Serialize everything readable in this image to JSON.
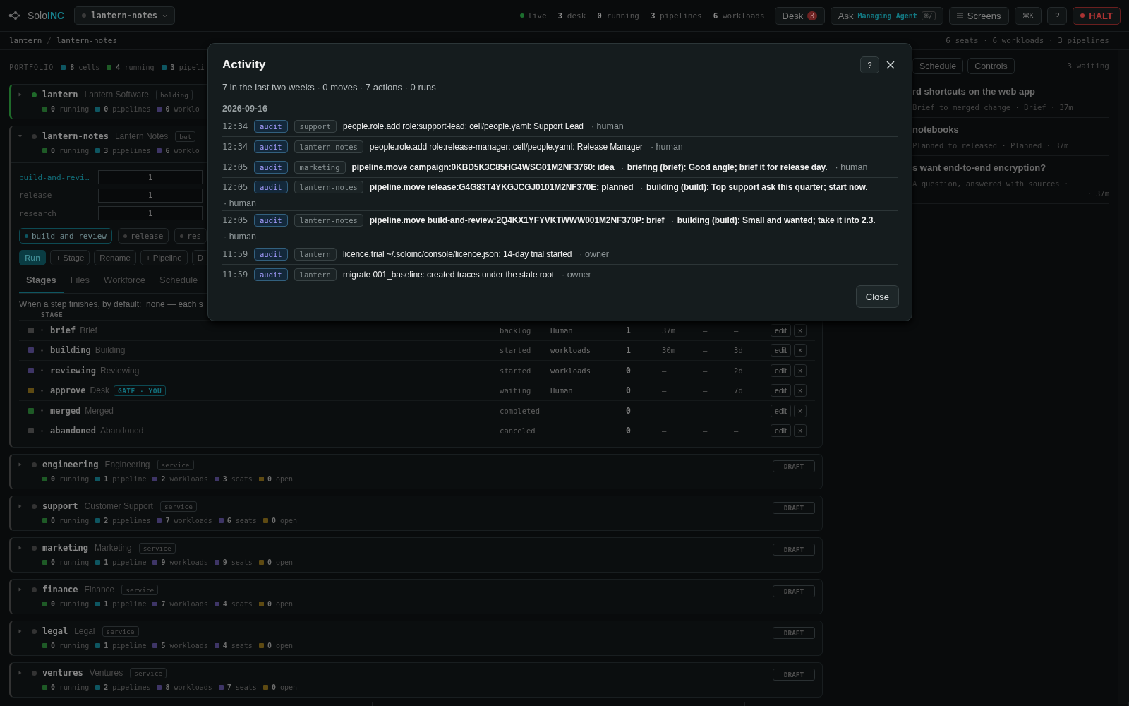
{
  "topbar": {
    "brand": {
      "prefix": "Solo",
      "suffix": "INC"
    },
    "project": "lantern-notes",
    "live": {
      "label": "live",
      "on": true
    },
    "counts": [
      "**3** desk",
      "**0** running",
      "**3** pipelines",
      "**6** workloads"
    ],
    "desk": {
      "label": "Desk",
      "badge": "3"
    },
    "ask": {
      "label": "Ask",
      "agent": "Managing Agent",
      "shortcut": "⌘/"
    },
    "screens": "Screens",
    "command": "⌘K",
    "help": "?",
    "halt": "HALT"
  },
  "breadcrumb": {
    "items": [
      "lantern",
      "lantern-notes"
    ],
    "separator": "/",
    "summary": "6 seats · 6 workloads · 3 pipelines"
  },
  "portfolio": {
    "label": "PORTFOLIO",
    "stats": [
      {
        "value": "8",
        "label": "cells",
        "color": "#0e5661"
      },
      {
        "value": "4",
        "label": "running",
        "color": "#1e5a26"
      },
      {
        "value": "3",
        "label": "pipeli",
        "color": "#0e5661"
      }
    ]
  },
  "cells": [
    {
      "name": "lantern",
      "title": "Lantern Software",
      "tag": "holding",
      "color": "#1f6a2a",
      "expanded": false,
      "stats": [
        {
          "value": "0",
          "label": "running",
          "color": "#1e5a26"
        },
        {
          "value": "0",
          "label": "pipelines",
          "color": "#0e5661"
        },
        {
          "value": "0",
          "label": "worklo",
          "color": "#3e3566"
        }
      ]
    },
    {
      "name": "lantern-notes",
      "title": "Lantern Notes",
      "tag": "bet",
      "color": "#333333",
      "expanded": true,
      "stats": [
        {
          "value": "0",
          "label": "running",
          "color": "#1e5a26"
        },
        {
          "value": "3",
          "label": "pipelines",
          "color": "#0e5661"
        },
        {
          "value": "6",
          "label": "worklo",
          "color": "#3e3566"
        }
      ],
      "detail": {
        "pipelines": [
          {
            "name": "build-and-revi…",
            "value": "1",
            "selected": true
          },
          {
            "name": "release",
            "value": "1",
            "selected": false
          },
          {
            "name": "research",
            "value": "1",
            "selected": false
          }
        ],
        "pills": [
          {
            "label": "build-and-review",
            "selected": true
          },
          {
            "label": "release",
            "selected": false
          },
          {
            "label": "res",
            "selected": false
          }
        ],
        "actions": [
          {
            "label": "Run",
            "kind": "primary"
          },
          {
            "label": "+ Stage",
            "kind": "secondary"
          },
          {
            "label": "Rename",
            "kind": "secondary"
          },
          {
            "label": "+ Pipeline",
            "kind": "secondary"
          },
          {
            "label": "D",
            "kind": "secondary"
          }
        ],
        "tabs": [
          {
            "label": "Stages",
            "selected": true
          },
          {
            "label": "Files",
            "selected": false
          },
          {
            "label": "Workforce",
            "selected": false
          },
          {
            "label": "Schedule",
            "selected": false
          }
        ],
        "hint": "When a step finishes, by default:  none — each s",
        "column": "STAGE",
        "stages": [
          {
            "name": "brief",
            "title": "Brief",
            "state": "backlog",
            "owner": "Human",
            "count": "1",
            "age": "37m",
            "col_a": "—",
            "col_b": "—",
            "color": "#3a3a3a",
            "edit": "edit",
            "remove": "×"
          },
          {
            "name": "building",
            "title": "Building",
            "state": "started",
            "owner": "workloads",
            "count": "1",
            "age": "30m",
            "col_a": "—",
            "col_b": "3d",
            "color": "#3e3566",
            "edit": "edit",
            "remove": "×"
          },
          {
            "name": "reviewing",
            "title": "Reviewing",
            "state": "started",
            "owner": "workloads",
            "count": "0",
            "age": "—",
            "col_a": "—",
            "col_b": "2d",
            "color": "#3e3566",
            "edit": "edit",
            "remove": "×"
          },
          {
            "name": "approve",
            "title": "Desk",
            "tag": "GATE · YOU",
            "state": "waiting",
            "owner": "Human",
            "count": "0",
            "age": "—",
            "col_a": "—",
            "col_b": "7d",
            "color": "#5e4a12",
            "edit": "edit",
            "remove": "×"
          },
          {
            "name": "merged",
            "title": "Merged",
            "state": "completed",
            "count": "0",
            "age": "—",
            "col_a": "—",
            "col_b": "—",
            "color": "#1e5a26",
            "edit": "edit",
            "remove": "×"
          },
          {
            "name": "abandoned",
            "title": "Abandoned",
            "state": "canceled",
            "count": "0",
            "age": "—",
            "col_a": "—",
            "col_b": "—",
            "color": "#3a3a3a",
            "edit": "edit",
            "remove": "×"
          }
        ]
      }
    },
    {
      "name": "engineering",
      "title": "Engineering",
      "tag": "service",
      "color": "#333333",
      "expanded": false,
      "action": "DRAFT",
      "stats": [
        {
          "value": "0",
          "label": "running",
          "color": "#1e5a26"
        },
        {
          "value": "1",
          "label": "pipeline",
          "color": "#0e5661"
        },
        {
          "value": "2",
          "label": "workloads",
          "color": "#3e3566"
        },
        {
          "value": "3",
          "label": "seats",
          "color": "#3e3566"
        },
        {
          "value": "0",
          "label": "open",
          "color": "#5e4a12"
        }
      ]
    },
    {
      "name": "support",
      "title": "Customer Support",
      "tag": "service",
      "color": "#333333",
      "expanded": false,
      "action": "DRAFT",
      "stats": [
        {
          "value": "0",
          "label": "running",
          "color": "#1e5a26"
        },
        {
          "value": "2",
          "label": "pipelines",
          "color": "#0e5661"
        },
        {
          "value": "7",
          "label": "workloads",
          "color": "#3e3566"
        },
        {
          "value": "6",
          "label": "seats",
          "color": "#3e3566"
        },
        {
          "value": "0",
          "label": "open",
          "color": "#5e4a12"
        }
      ]
    },
    {
      "name": "marketing",
      "title": "Marketing",
      "tag": "service",
      "color": "#333333",
      "expanded": false,
      "action": "DRAFT",
      "stats": [
        {
          "value": "0",
          "label": "running",
          "color": "#1e5a26"
        },
        {
          "value": "1",
          "label": "pipeline",
          "color": "#0e5661"
        },
        {
          "value": "9",
          "label": "workloads",
          "color": "#3e3566"
        },
        {
          "value": "9",
          "label": "seats",
          "color": "#3e3566"
        },
        {
          "value": "0",
          "label": "open",
          "color": "#5e4a12"
        }
      ]
    },
    {
      "name": "finance",
      "title": "Finance",
      "tag": "service",
      "color": "#333333",
      "expanded": false,
      "action": "DRAFT",
      "stats": [
        {
          "value": "0",
          "label": "running",
          "color": "#1e5a26"
        },
        {
          "value": "1",
          "label": "pipeline",
          "color": "#0e5661"
        },
        {
          "value": "7",
          "label": "workloads",
          "color": "#3e3566"
        },
        {
          "value": "4",
          "label": "seats",
          "color": "#3e3566"
        },
        {
          "value": "0",
          "label": "open",
          "color": "#5e4a12"
        }
      ]
    },
    {
      "name": "legal",
      "title": "Legal",
      "tag": "service",
      "color": "#333333",
      "expanded": false,
      "action": "DRAFT",
      "stats": [
        {
          "value": "0",
          "label": "running",
          "color": "#1e5a26"
        },
        {
          "value": "1",
          "label": "pipeline",
          "color": "#0e5661"
        },
        {
          "value": "5",
          "label": "workloads",
          "color": "#3e3566"
        },
        {
          "value": "4",
          "label": "seats",
          "color": "#3e3566"
        },
        {
          "value": "0",
          "label": "open",
          "color": "#5e4a12"
        }
      ]
    },
    {
      "name": "ventures",
      "title": "Ventures",
      "tag": "service",
      "color": "#333333",
      "expanded": false,
      "action": "DRAFT",
      "stats": [
        {
          "value": "0",
          "label": "running",
          "color": "#1e5a26"
        },
        {
          "value": "2",
          "label": "pipelines",
          "color": "#0e5661"
        },
        {
          "value": "8",
          "label": "workloads",
          "color": "#3e3566"
        },
        {
          "value": "7",
          "label": "seats",
          "color": "#3e3566"
        },
        {
          "value": "0",
          "label": "open",
          "color": "#5e4a12"
        }
      ]
    }
  ],
  "right_panel": {
    "tabs": [
      "Schedule",
      "Controls"
    ],
    "waiting": "3 waiting",
    "items": [
      {
        "title": "rd shortcuts on the web app",
        "meta": "Brief to merged change · Brief · 37m"
      },
      {
        "title": "notebooks",
        "meta": "Planned to released · Planned · 37m"
      },
      {
        "title": "s want end-to-end encryption?",
        "meta": "A question, answered with sources ·",
        "time": "· 37m"
      }
    ]
  },
  "modal": {
    "title": "Activity",
    "help": "?",
    "summary": "7 in the last two weeks · 0 moves · 7 actions · 0 runs",
    "date": "2026-09-16",
    "close": "Close",
    "entries": [
      {
        "time": "12:34",
        "category": "audit",
        "scope": "support",
        "text": "people.role.add role:support-lead: cell/people.yaml: Support Lead",
        "bold": false,
        "actor": "· human"
      },
      {
        "time": "12:34",
        "category": "audit",
        "scope": "lantern-notes",
        "text": "people.role.add role:release-manager: cell/people.yaml: Release Manager",
        "bold": false,
        "actor": "· human"
      },
      {
        "time": "12:05",
        "category": "audit",
        "scope": "marketing",
        "text": "pipeline.move campaign:0KBD5K3C85HG4WSG01M2NF3760: idea → briefing (brief): Good angle; brief it for release day.",
        "bold": true,
        "actor": "· human"
      },
      {
        "time": "12:05",
        "category": "audit",
        "scope": "lantern-notes",
        "text": "pipeline.move release:G4G83T4YKGJCGJ0101M2NF370E: planned → building (build): Top support ask this quarter; start now.",
        "bold": true,
        "actor": "· human"
      },
      {
        "time": "12:05",
        "category": "audit",
        "scope": "lantern-notes",
        "text": "pipeline.move build-and-review:2Q4KX1YFYVKTWWW001M2NF370P: brief → building (build): Small and wanted; take it into 2.3.",
        "bold": true,
        "actor": "· human"
      },
      {
        "time": "11:59",
        "category": "audit",
        "scope": "lantern",
        "text": "licence.trial ~/.soloinc/console/licence.json: 14-day trial started",
        "bold": false,
        "actor": "· owner"
      },
      {
        "time": "11:59",
        "category": "audit",
        "scope": "lantern",
        "text": "migrate 001_baseline: created traces under the state root",
        "bold": false,
        "actor": "· owner"
      }
    ]
  }
}
